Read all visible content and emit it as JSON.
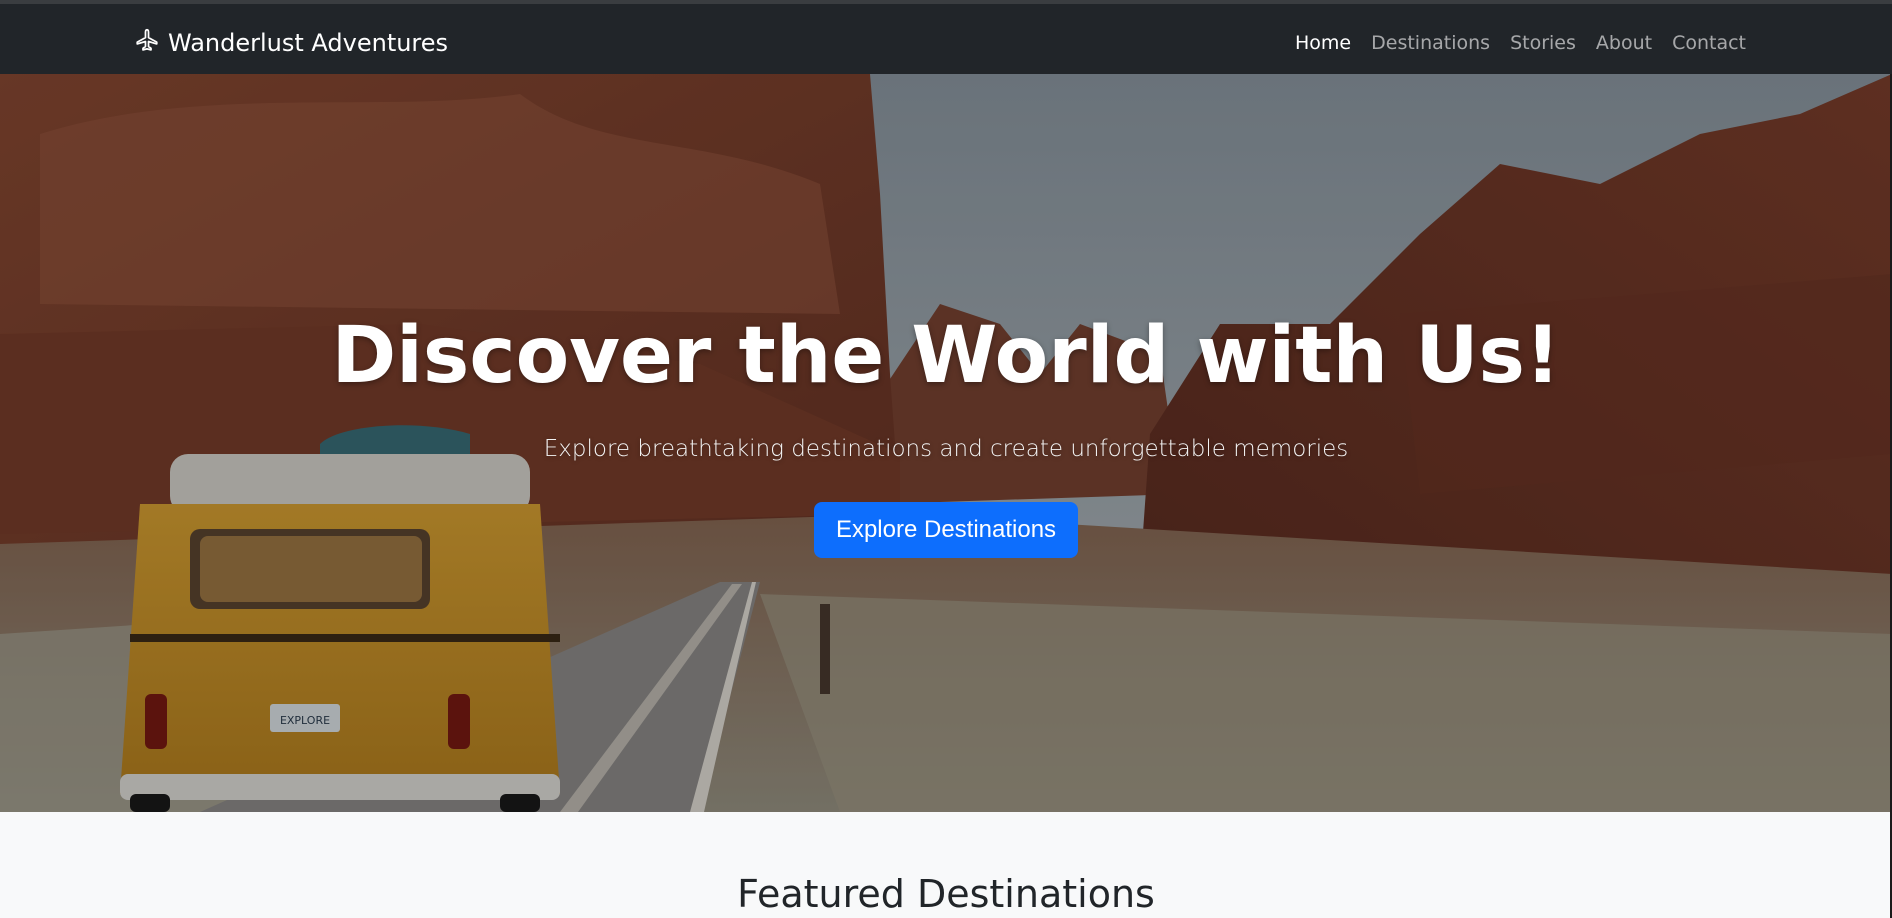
{
  "navbar": {
    "brand": "Wanderlust Adventures",
    "brand_icon": "airplane-icon",
    "links": [
      {
        "label": "Home",
        "active": true
      },
      {
        "label": "Destinations",
        "active": false
      },
      {
        "label": "Stories",
        "active": false
      },
      {
        "label": "About",
        "active": false
      },
      {
        "label": "Contact",
        "active": false
      }
    ]
  },
  "hero": {
    "title": "Discover the World with Us!",
    "subtitle": "Explore breathtaking destinations and create unforgettable memories",
    "cta_label": "Explore Destinations",
    "license_plate": "EXPLORE"
  },
  "featured": {
    "title": "Featured Destinations"
  },
  "colors": {
    "navbar_bg": "#212529",
    "primary": "#0d6efd",
    "page_bg": "#f8f9fa"
  }
}
